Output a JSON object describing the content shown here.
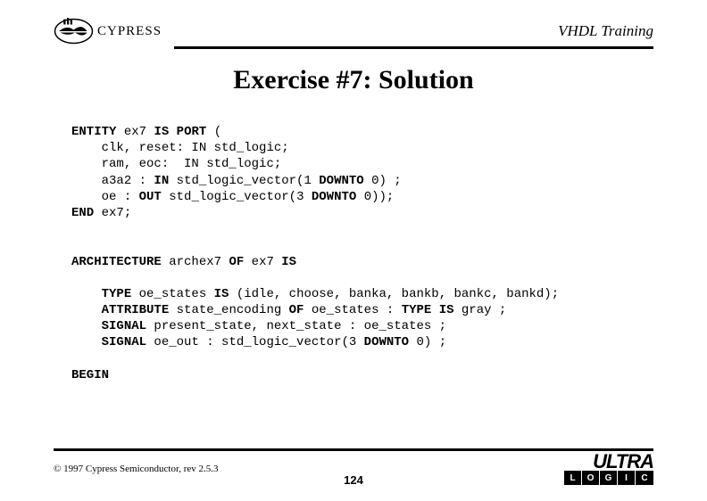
{
  "header": {
    "company": "CYPRESS",
    "title": "VHDL Training"
  },
  "title": "Exercise #7: Solution",
  "code": {
    "kw_entity": "ENTITY",
    "e_name": "ex7",
    "kw_is": "IS",
    "kw_port": "PORT",
    "paren_open": "(",
    "line1": "clk, reset: IN std_logic;",
    "line2": "ram, eoc:  IN std_logic;",
    "line3_a": "a3a2 : ",
    "kw_in": "IN",
    "line3_b": " std_logic_vector(1 ",
    "kw_downto1": "DOWNTO",
    "line3_c": " 0) ;",
    "line4_a": "oe : ",
    "kw_out": "OUT",
    "line4_b": " std_logic_vector(3 ",
    "kw_downto2": "DOWNTO",
    "line4_c": " 0));",
    "kw_end": "END",
    "end_name": " ex7;",
    "kw_arch": "ARCHITECTURE",
    "arch_name": " archex7 ",
    "kw_of": "OF",
    "of_name": " ex7 ",
    "kw_is2": "IS",
    "kw_type": "TYPE",
    "type_a": " oe_states ",
    "kw_is3": "IS",
    "type_b": " (idle, choose, banka, bankb, bankc, bankd);",
    "kw_attr": "ATTRIBUTE",
    "attr_a": " state_encoding ",
    "kw_of2": "OF",
    "attr_b": " oe_states : ",
    "kw_typeis": "TYPE IS",
    "attr_c": " gray ;",
    "kw_signal1": "SIGNAL",
    "sig1": " present_state, next_state : oe_states ;",
    "kw_signal2": "SIGNAL",
    "sig2_a": " oe_out : std_logic_vector(3 ",
    "kw_downto3": "DOWNTO",
    "sig2_b": " 0) ;",
    "kw_begin": "BEGIN"
  },
  "footer": {
    "copyright": "© 1997 Cypress Semiconductor, rev 2.5.3",
    "page": "124",
    "ultra": "ULTRA",
    "ultra_sub": [
      "L",
      "O",
      "G",
      "I",
      "C"
    ]
  }
}
